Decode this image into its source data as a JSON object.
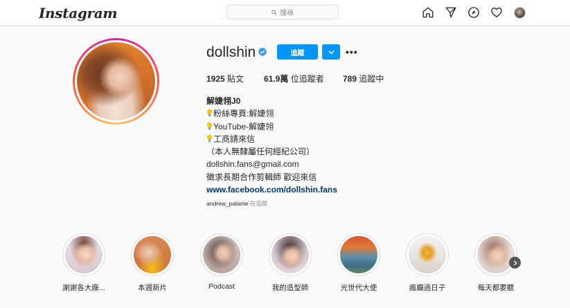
{
  "nav": {
    "logo": "Instagram",
    "search_placeholder": "搜尋",
    "icons": [
      "home-icon",
      "direct-icon",
      "explore-icon",
      "activity-heart-icon",
      "profile-avatar"
    ]
  },
  "profile": {
    "username": "dollshin",
    "verified": true,
    "follow_label": "追蹤",
    "stats": {
      "posts_count": "1925",
      "posts_label": "貼文",
      "followers_count": "61.9萬",
      "followers_label": "位追蹤者",
      "following_count": "789",
      "following_label": "追蹤中"
    },
    "bio": {
      "name": "解婕翎J0",
      "line1": "粉絲專頁:解婕翎",
      "line2": "YouTube-解婕翎",
      "line3": "工商請來信",
      "line4": "（本人無隸屬任何經紀公司）",
      "line5": "dollshin.fans@gmail.com",
      "line6": "徵求長期合作剪輯師 歡迎來信",
      "link": "www.facebook.com/dollshin.fans"
    },
    "followed_by_user": "andrew_patanie",
    "followed_by_suffix": "在追蹤"
  },
  "highlights": [
    {
      "label": "謝謝各大廠..."
    },
    {
      "label": "本週新片"
    },
    {
      "label": "Podcast"
    },
    {
      "label": "我的造型師"
    },
    {
      "label": "光世代大使"
    },
    {
      "label": "瘋癲過日子"
    },
    {
      "label": "每天都要聽"
    }
  ],
  "colors": {
    "accent": "#0095f6",
    "link": "#00376b",
    "muted": "#8e8e8e",
    "border": "#dbdbdb"
  }
}
